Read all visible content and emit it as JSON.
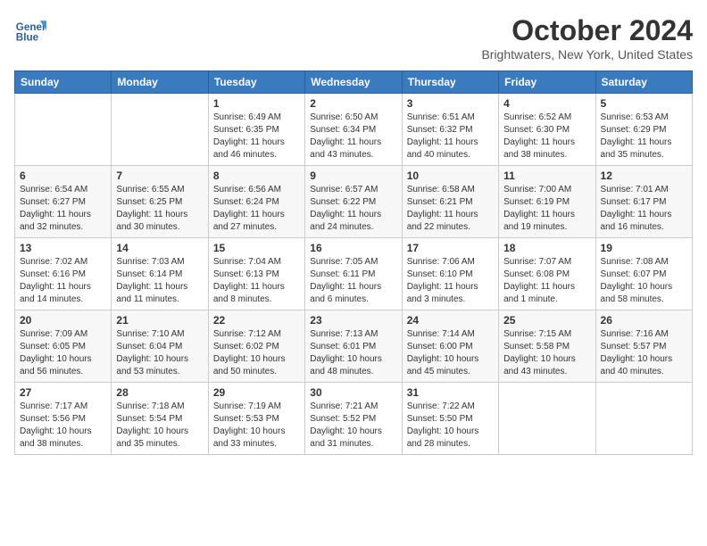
{
  "logo": {
    "line1": "General",
    "line2": "Blue"
  },
  "title": "October 2024",
  "location": "Brightwaters, New York, United States",
  "headers": [
    "Sunday",
    "Monday",
    "Tuesday",
    "Wednesday",
    "Thursday",
    "Friday",
    "Saturday"
  ],
  "weeks": [
    [
      {
        "day": "",
        "sunrise": "",
        "sunset": "",
        "daylight": ""
      },
      {
        "day": "",
        "sunrise": "",
        "sunset": "",
        "daylight": ""
      },
      {
        "day": "1",
        "sunrise": "Sunrise: 6:49 AM",
        "sunset": "Sunset: 6:35 PM",
        "daylight": "Daylight: 11 hours and 46 minutes."
      },
      {
        "day": "2",
        "sunrise": "Sunrise: 6:50 AM",
        "sunset": "Sunset: 6:34 PM",
        "daylight": "Daylight: 11 hours and 43 minutes."
      },
      {
        "day": "3",
        "sunrise": "Sunrise: 6:51 AM",
        "sunset": "Sunset: 6:32 PM",
        "daylight": "Daylight: 11 hours and 40 minutes."
      },
      {
        "day": "4",
        "sunrise": "Sunrise: 6:52 AM",
        "sunset": "Sunset: 6:30 PM",
        "daylight": "Daylight: 11 hours and 38 minutes."
      },
      {
        "day": "5",
        "sunrise": "Sunrise: 6:53 AM",
        "sunset": "Sunset: 6:29 PM",
        "daylight": "Daylight: 11 hours and 35 minutes."
      }
    ],
    [
      {
        "day": "6",
        "sunrise": "Sunrise: 6:54 AM",
        "sunset": "Sunset: 6:27 PM",
        "daylight": "Daylight: 11 hours and 32 minutes."
      },
      {
        "day": "7",
        "sunrise": "Sunrise: 6:55 AM",
        "sunset": "Sunset: 6:25 PM",
        "daylight": "Daylight: 11 hours and 30 minutes."
      },
      {
        "day": "8",
        "sunrise": "Sunrise: 6:56 AM",
        "sunset": "Sunset: 6:24 PM",
        "daylight": "Daylight: 11 hours and 27 minutes."
      },
      {
        "day": "9",
        "sunrise": "Sunrise: 6:57 AM",
        "sunset": "Sunset: 6:22 PM",
        "daylight": "Daylight: 11 hours and 24 minutes."
      },
      {
        "day": "10",
        "sunrise": "Sunrise: 6:58 AM",
        "sunset": "Sunset: 6:21 PM",
        "daylight": "Daylight: 11 hours and 22 minutes."
      },
      {
        "day": "11",
        "sunrise": "Sunrise: 7:00 AM",
        "sunset": "Sunset: 6:19 PM",
        "daylight": "Daylight: 11 hours and 19 minutes."
      },
      {
        "day": "12",
        "sunrise": "Sunrise: 7:01 AM",
        "sunset": "Sunset: 6:17 PM",
        "daylight": "Daylight: 11 hours and 16 minutes."
      }
    ],
    [
      {
        "day": "13",
        "sunrise": "Sunrise: 7:02 AM",
        "sunset": "Sunset: 6:16 PM",
        "daylight": "Daylight: 11 hours and 14 minutes."
      },
      {
        "day": "14",
        "sunrise": "Sunrise: 7:03 AM",
        "sunset": "Sunset: 6:14 PM",
        "daylight": "Daylight: 11 hours and 11 minutes."
      },
      {
        "day": "15",
        "sunrise": "Sunrise: 7:04 AM",
        "sunset": "Sunset: 6:13 PM",
        "daylight": "Daylight: 11 hours and 8 minutes."
      },
      {
        "day": "16",
        "sunrise": "Sunrise: 7:05 AM",
        "sunset": "Sunset: 6:11 PM",
        "daylight": "Daylight: 11 hours and 6 minutes."
      },
      {
        "day": "17",
        "sunrise": "Sunrise: 7:06 AM",
        "sunset": "Sunset: 6:10 PM",
        "daylight": "Daylight: 11 hours and 3 minutes."
      },
      {
        "day": "18",
        "sunrise": "Sunrise: 7:07 AM",
        "sunset": "Sunset: 6:08 PM",
        "daylight": "Daylight: 11 hours and 1 minute."
      },
      {
        "day": "19",
        "sunrise": "Sunrise: 7:08 AM",
        "sunset": "Sunset: 6:07 PM",
        "daylight": "Daylight: 10 hours and 58 minutes."
      }
    ],
    [
      {
        "day": "20",
        "sunrise": "Sunrise: 7:09 AM",
        "sunset": "Sunset: 6:05 PM",
        "daylight": "Daylight: 10 hours and 56 minutes."
      },
      {
        "day": "21",
        "sunrise": "Sunrise: 7:10 AM",
        "sunset": "Sunset: 6:04 PM",
        "daylight": "Daylight: 10 hours and 53 minutes."
      },
      {
        "day": "22",
        "sunrise": "Sunrise: 7:12 AM",
        "sunset": "Sunset: 6:02 PM",
        "daylight": "Daylight: 10 hours and 50 minutes."
      },
      {
        "day": "23",
        "sunrise": "Sunrise: 7:13 AM",
        "sunset": "Sunset: 6:01 PM",
        "daylight": "Daylight: 10 hours and 48 minutes."
      },
      {
        "day": "24",
        "sunrise": "Sunrise: 7:14 AM",
        "sunset": "Sunset: 6:00 PM",
        "daylight": "Daylight: 10 hours and 45 minutes."
      },
      {
        "day": "25",
        "sunrise": "Sunrise: 7:15 AM",
        "sunset": "Sunset: 5:58 PM",
        "daylight": "Daylight: 10 hours and 43 minutes."
      },
      {
        "day": "26",
        "sunrise": "Sunrise: 7:16 AM",
        "sunset": "Sunset: 5:57 PM",
        "daylight": "Daylight: 10 hours and 40 minutes."
      }
    ],
    [
      {
        "day": "27",
        "sunrise": "Sunrise: 7:17 AM",
        "sunset": "Sunset: 5:56 PM",
        "daylight": "Daylight: 10 hours and 38 minutes."
      },
      {
        "day": "28",
        "sunrise": "Sunrise: 7:18 AM",
        "sunset": "Sunset: 5:54 PM",
        "daylight": "Daylight: 10 hours and 35 minutes."
      },
      {
        "day": "29",
        "sunrise": "Sunrise: 7:19 AM",
        "sunset": "Sunset: 5:53 PM",
        "daylight": "Daylight: 10 hours and 33 minutes."
      },
      {
        "day": "30",
        "sunrise": "Sunrise: 7:21 AM",
        "sunset": "Sunset: 5:52 PM",
        "daylight": "Daylight: 10 hours and 31 minutes."
      },
      {
        "day": "31",
        "sunrise": "Sunrise: 7:22 AM",
        "sunset": "Sunset: 5:50 PM",
        "daylight": "Daylight: 10 hours and 28 minutes."
      },
      {
        "day": "",
        "sunrise": "",
        "sunset": "",
        "daylight": ""
      },
      {
        "day": "",
        "sunrise": "",
        "sunset": "",
        "daylight": ""
      }
    ]
  ]
}
